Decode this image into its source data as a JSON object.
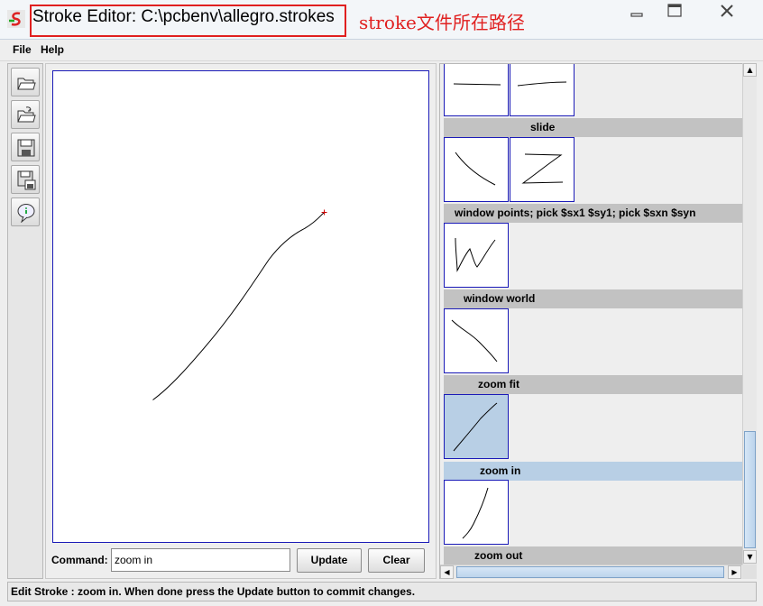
{
  "window": {
    "title": "Stroke Editor: C:\\pcbenv\\allegro.strokes",
    "annotation": "stroke文件所在路径",
    "minimize_icon": "minimize-icon",
    "maximize_icon": "maximize-icon",
    "close_icon": "close-icon"
  },
  "menu": {
    "file": "File",
    "help": "Help"
  },
  "toolbar": {
    "tools": [
      "open-folder-icon",
      "reload-folder-icon",
      "save-icon",
      "save-as-icon",
      "info-icon"
    ]
  },
  "command": {
    "label": "Command:",
    "value": "zoom in",
    "update_label": "Update",
    "clear_label": "Clear"
  },
  "strokes": [
    {
      "caption": "slide",
      "selected": false
    },
    {
      "caption": "window points; pick $sx1 $sy1; pick $sxn $syn",
      "selected": false
    },
    {
      "caption": "window world",
      "selected": false
    },
    {
      "caption": "zoom fit",
      "selected": false
    },
    {
      "caption": "zoom in",
      "selected": true
    },
    {
      "caption": "zoom out",
      "selected": false
    }
  ],
  "status": {
    "text": "Edit Stroke : zoom in. When done press the Update button to commit changes."
  },
  "colors": {
    "annotation": "#e02020",
    "selection": "#b8cfe5",
    "thumb_border": "#1b1bb8"
  }
}
